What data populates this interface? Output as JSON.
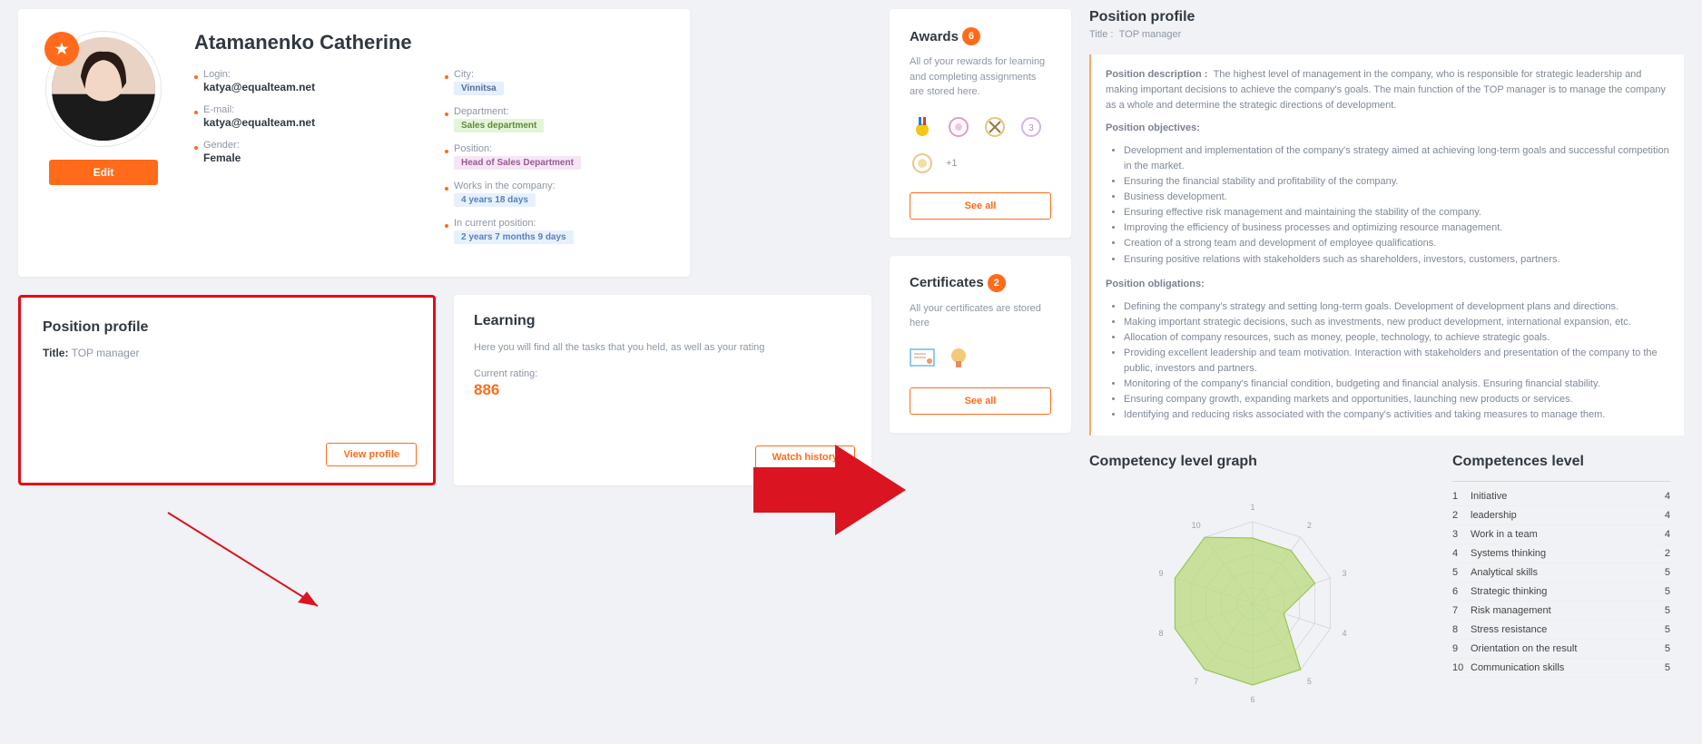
{
  "profile": {
    "name": "Atamanenko Catherine",
    "edit_label": "Edit",
    "login_label": "Login:",
    "login_value": "katya@equalteam.net",
    "email_label": "E-mail:",
    "email_value": "katya@equalteam.net",
    "gender_label": "Gender:",
    "gender_value": "Female",
    "city_label": "City:",
    "city_value": "Vinnitsa",
    "dept_label": "Department:",
    "dept_value": "Sales department",
    "position_label": "Position:",
    "position_value": "Head of Sales Department",
    "works_label": "Works in the company:",
    "works_value": "4 years  18 days",
    "curpos_label": "In current position:",
    "curpos_value": "2 years  7 months  9 days"
  },
  "awards": {
    "title": "Awards",
    "count": "6",
    "desc": "All of your rewards for learning and completing assignments are stored here.",
    "see_all": "See all",
    "extra": "+1"
  },
  "certs": {
    "title": "Certificates",
    "count": "2",
    "desc": "All your certificates are stored here",
    "see_all": "See all"
  },
  "position_profile": {
    "title": "Position profile",
    "sub_label": "Title:",
    "sub_value": "TOP manager",
    "view_btn": "View profile"
  },
  "learning": {
    "title": "Learning",
    "desc": "Here you will find all the tasks that you held, as well as your rating",
    "rating_label": "Current rating:",
    "rating_value": "886",
    "watch_btn": "Watch history"
  },
  "right": {
    "header": "Position profile",
    "sub_label": "Title :",
    "sub_value": "TOP manager",
    "desc_label": "Position description :",
    "desc_text": "The highest level of management in the company, who is responsible for strategic leadership and making important decisions to achieve the company's goals. The main function of the TOP manager is to manage the company as a whole and determine the strategic directions of development.",
    "objectives_label": "Position objectives:",
    "objectives": [
      "Development and implementation of the company's strategy aimed at achieving long-term goals and successful competition in the market.",
      "Ensuring the financial stability and profitability of the company.",
      "Business development.",
      "Ensuring effective risk management and maintaining the stability of the company.",
      "Improving the efficiency of business processes and optimizing resource management.",
      "Creation of a strong team and development of employee qualifications.",
      "Ensuring positive relations with stakeholders such as shareholders, investors, customers, partners."
    ],
    "obligations_label": "Position obligations:",
    "obligations": [
      "Defining the company's strategy and setting long-term goals. Development of development plans and directions.",
      "Making important strategic decisions, such as investments, new product development, international expansion, etc.",
      "Allocation of company resources, such as money, people, technology, to achieve strategic goals.",
      "Providing excellent leadership and team motivation. Interaction with stakeholders and presentation of the company to the public, investors and partners.",
      "Monitoring of the company's financial condition, budgeting and financial analysis. Ensuring financial stability.",
      "Ensuring company growth, expanding markets and opportunities, launching new products or services.",
      "Identifying and reducing risks associated with the company's activities and taking measures to manage them."
    ],
    "graph_title": "Competency level graph",
    "comp_title": "Competences level",
    "competences": [
      {
        "n": "1",
        "name": "Initiative",
        "val": "4"
      },
      {
        "n": "2",
        "name": "leadership",
        "val": "4"
      },
      {
        "n": "3",
        "name": "Work in a team",
        "val": "4"
      },
      {
        "n": "4",
        "name": "Systems thinking",
        "val": "2"
      },
      {
        "n": "5",
        "name": "Analytical skills",
        "val": "5"
      },
      {
        "n": "6",
        "name": "Strategic thinking",
        "val": "5"
      },
      {
        "n": "7",
        "name": "Risk management",
        "val": "5"
      },
      {
        "n": "8",
        "name": "Stress resistance",
        "val": "5"
      },
      {
        "n": "9",
        "name": "Orientation on the result",
        "val": "5"
      },
      {
        "n": "10",
        "name": "Communication skills",
        "val": "5"
      }
    ]
  },
  "chart_data": {
    "type": "radar",
    "categories_numbered": [
      "1",
      "2",
      "3",
      "4",
      "5",
      "6",
      "7",
      "8",
      "9",
      "10"
    ],
    "max": 5,
    "values": [
      4,
      4,
      4,
      2,
      5,
      5,
      5,
      5,
      5,
      5
    ]
  }
}
